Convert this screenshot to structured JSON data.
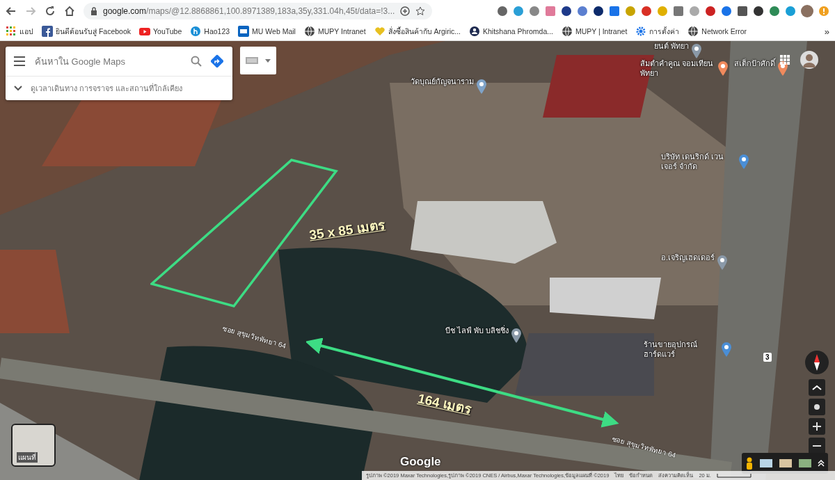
{
  "browser": {
    "url_host": "google.com",
    "url_path": "/maps/@12.8868861,100.8971389,183a,35y,331.04h,45t/data=!3...",
    "bookmarks": [
      {
        "label": "แอป",
        "kind": "apps"
      },
      {
        "label": "ยินดีต้อนรับสู่ Facebook",
        "kind": "facebook"
      },
      {
        "label": "YouTube",
        "kind": "youtube"
      },
      {
        "label": "Hao123",
        "kind": "hao"
      },
      {
        "label": "MU Web Mail",
        "kind": "mail"
      },
      {
        "label": "MUPY  Intranet",
        "kind": "globe"
      },
      {
        "label": "สั่งซื้อสินค้ากับ Argiric...",
        "kind": "heart"
      },
      {
        "label": "Khitshana Phromda...",
        "kind": "person"
      },
      {
        "label": "MUPY | Intranet",
        "kind": "globe"
      },
      {
        "label": "การตั้งค่า",
        "kind": "gear"
      },
      {
        "label": "Network Error",
        "kind": "globe"
      }
    ],
    "more_bookmarks": "»"
  },
  "search": {
    "placeholder": "ค้นหาใน Google Maps",
    "hint": "ดูเวลาเดินทาง การจราจร และสถานที่ใกล้เคียง"
  },
  "places": [
    {
      "name": "ยนต์ พัทยา",
      "kind": "pin"
    },
    {
      "name": "ส้มตำคำคูณ จอมเทียน พัทยา",
      "kind": "food"
    },
    {
      "name": "สเต็กป้าศักดิ์",
      "kind": "food"
    },
    {
      "name": "วัดบุณย์กัญจนาราม",
      "kind": "temple"
    },
    {
      "name": "บริษัท เดนริกด์ เวนเจอร์ จำกัด",
      "kind": "shop"
    },
    {
      "name": "อ.เจริญเฮดเดอร์",
      "kind": "pin"
    },
    {
      "name": "บีช ไลฟ์ พับ บลิชชิ่ง",
      "kind": "pin"
    },
    {
      "name": "ร้านขายอุปกรณ์ ฮาร์ดแวร์",
      "kind": "shop"
    }
  ],
  "roads": [
    "ซอย สุขุมวิทพัทยา 64",
    "ซอย สุขุมวิทพัทยา 64"
  ],
  "route_shield": "3",
  "annotations": {
    "plot_size": "35 x 85 เมตร",
    "distance": "164 เมตร"
  },
  "layer_thumbnail": "แผนที่",
  "logo": "Google",
  "footer": {
    "attribution": "รูปภาพ ©2019 Maxar Technologies,รูปภาพ ©2019 CNES / Airbus,Maxar Technologies,ข้อมูลแผนที่ ©2019",
    "language": "ไทย",
    "terms": "ข้อกำหนด",
    "feedback": "ส่งความคิดเห็น",
    "scale": "20 ม."
  }
}
